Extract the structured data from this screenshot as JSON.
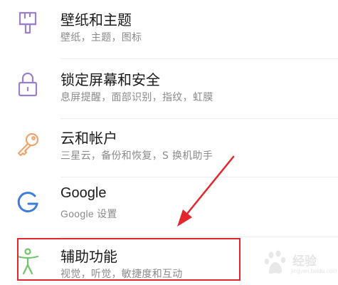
{
  "settings": {
    "items": [
      {
        "title": "壁纸和主题",
        "subtitle": "壁纸，主题，图标",
        "icon": "paintbrush-icon",
        "icon_color": "#9a7fd1"
      },
      {
        "title": "锁定屏幕和安全",
        "subtitle": "息屏提醒，面部识别，指纹，虹膜",
        "icon": "lock-icon",
        "icon_color": "#9a7fd1"
      },
      {
        "title": "云和帐户",
        "subtitle": "三星云，备份和恢复，S 换机助手",
        "icon": "key-icon",
        "icon_color": "#f0a36a"
      },
      {
        "title": "Google",
        "subtitle": "Google 设置",
        "icon": "google-icon",
        "icon_color": "#3b7dd8"
      },
      {
        "title": "辅助功能",
        "subtitle": "视觉，听觉，敏捷度和互动",
        "icon": "accessibility-person-icon",
        "icon_color": "#6ec46b"
      }
    ]
  },
  "annotation": {
    "highlight_color": "#e3262c",
    "highlighted_item": "辅助功能"
  },
  "watermark": {
    "text": "经验",
    "subtext": "jingyan.baidu.com"
  }
}
